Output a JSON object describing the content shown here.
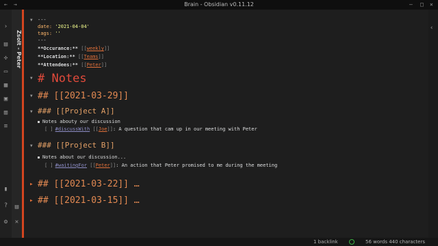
{
  "window": {
    "title": "Brain - Obsidian v0.11.12"
  },
  "ribbon": {
    "icons": [
      "chevron-left-icon",
      "file-icon",
      "graph-icon",
      "folder-icon",
      "grid-icon",
      "calendar-icon",
      "table-icon",
      "menu-icon",
      "book-icon",
      "help-icon",
      "settings-icon"
    ]
  },
  "tab": {
    "title": "Zsolt - Peter"
  },
  "note": {
    "frontmatter": {
      "open": "---",
      "date_key": "date:",
      "date_value": "'2021-04-04'",
      "tags_key": "tags:",
      "tags_value": "''",
      "close": "---"
    },
    "properties": [
      {
        "label": "**Occurance:**",
        "open": "[[",
        "link": "weekly",
        "close": "]]"
      },
      {
        "label": "**Location:**",
        "open": "[[",
        "link": "Teams",
        "close": "]]"
      },
      {
        "label": "**Attendees:**",
        "open": "[[",
        "link": "Peter",
        "close": "]]"
      }
    ],
    "h1": "# Notes",
    "sections": [
      {
        "heading": "## [[2021-03-29]]"
      },
      {
        "heading": "### [[Project A]]",
        "bullet": "Notes abouty our discussion",
        "task_box": "[ ]",
        "task_tag": "#discussWith",
        "task_link_open": "[[",
        "task_link": "Joe",
        "task_link_close": "]]",
        "task_text": ": A question that cam up in our meeting with Peter"
      },
      {
        "heading": "### [[Project B]]",
        "bullet": "Notes about our discussion...",
        "task_box": "[ ]",
        "task_tag": "#waitingFor",
        "task_link_open": "[[",
        "task_link": "Peter",
        "task_link_close": "]]",
        "task_text": ": An action that Peter promised to me during the meeting"
      },
      {
        "heading": "## [[2021-03-22]] …"
      },
      {
        "heading": "## [[2021-03-15]] …"
      }
    ]
  },
  "status": {
    "backlinks": "1 backlink",
    "counts": "56 words 440 characters"
  }
}
